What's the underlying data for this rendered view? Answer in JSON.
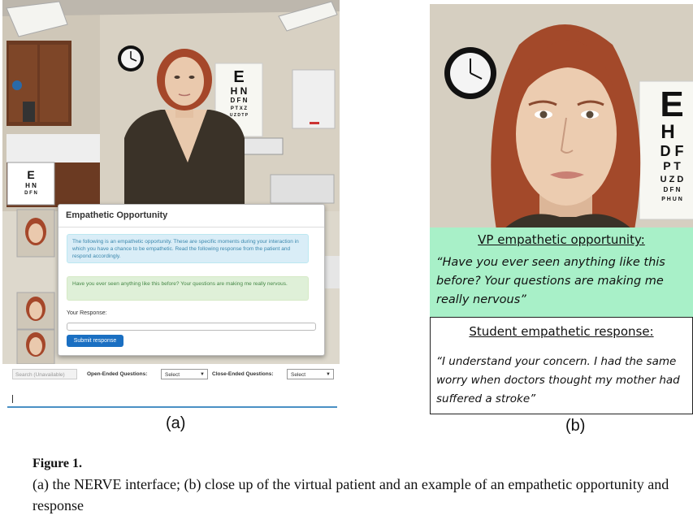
{
  "panel_a": {
    "eye_chart_letters": [
      "E",
      "H N",
      "D F N",
      "P T X Z",
      "U Z D T P"
    ],
    "thumb_chart_letters": [
      "E",
      "H N",
      "D F N"
    ],
    "dialog": {
      "title": "Empathetic Opportunity",
      "info": "The following is an empathetic opportunity. These are specific moments during your interaction in which you have a chance to be empathetic. Read the following response from the patient and respond accordingly.",
      "quote": "Have you ever seen anything like this before? Your questions are making me really nervous.",
      "response_label": "Your Response:",
      "submit_label": "Submit response"
    },
    "bottom_bar": {
      "search_placeholder": "Search (Unavailable)",
      "open_label": "Open-Ended Questions:",
      "open_select": "Select",
      "close_label": "Close-Ended Questions:",
      "close_select": "Select"
    },
    "label": "(a)"
  },
  "panel_b": {
    "eye_chart_letters": [
      "E",
      "H",
      "D F",
      "P T",
      "U Z D",
      "D F N",
      "P H U N"
    ],
    "vp_title": "VP empathetic opportunity:",
    "vp_text": "“Have you ever seen anything like this before? Your questions are making me really nervous”",
    "student_title": "Student empathetic response:",
    "student_text": "“I understand your concern. I had the same worry when doctors thought my mother had suffered a stroke”",
    "label": "(b)"
  },
  "caption": {
    "figure": "Figure 1.",
    "text": "(a) the NERVE interface; (b) close up of the virtual patient and an example of an empathetic opportunity and response"
  },
  "colors": {
    "vp_box": "#a8f0c8",
    "submit_button": "#1a6fc2",
    "info_alert": "#d9edf7",
    "quote_alert": "#dff0d8"
  }
}
